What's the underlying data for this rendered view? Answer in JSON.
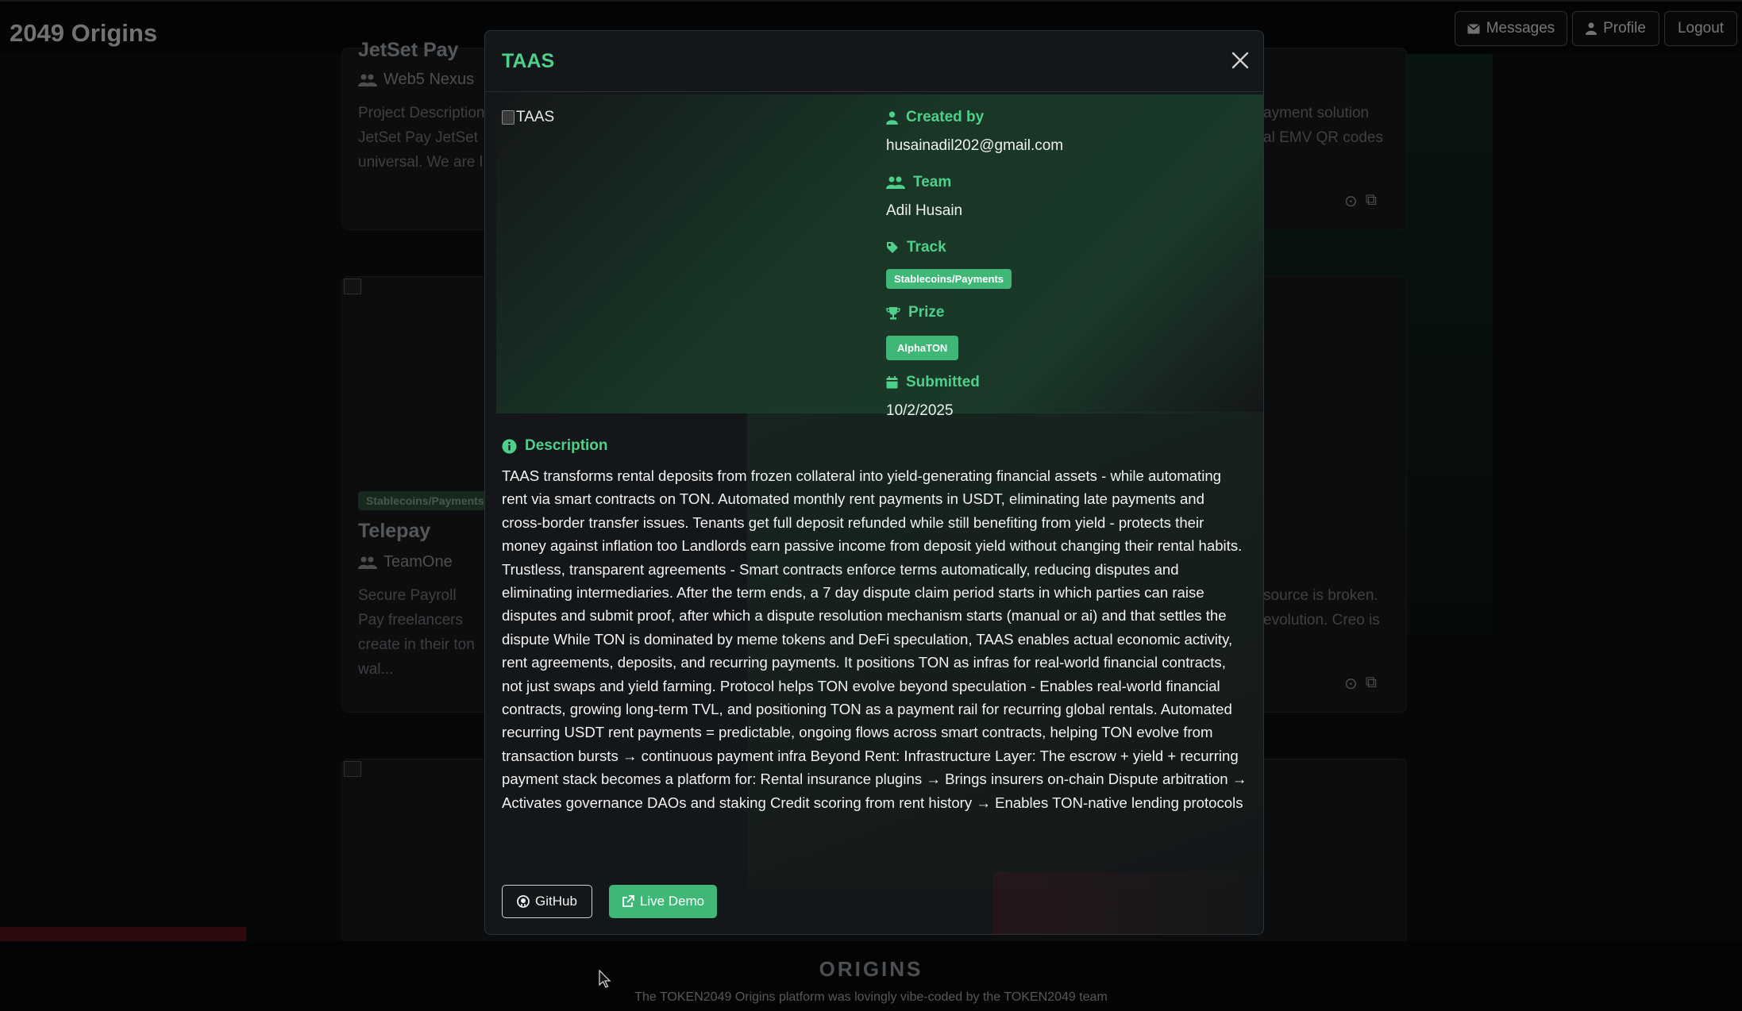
{
  "navbar": {
    "brand": "2049 Origins",
    "messages_label": "Messages",
    "profile_label": "Profile",
    "logout_label": "Logout"
  },
  "background_cards": [
    {
      "title": "JetSet Pay",
      "team": "Web5 Nexus",
      "description_left": "Project Description JetSet Pay JetSet universal. We are l",
      "description_right": [
        "ayment solution",
        "al EMV QR codes"
      ]
    },
    {
      "badge": "Stablecoins/Payments",
      "title": "Telepay",
      "team": "TeamOne",
      "description_left": "Secure Payroll Pay freelancers create in their ton wal...",
      "description_right": [
        "source is broken.",
        "evolution. Creo is"
      ]
    }
  ],
  "modal": {
    "title": "TAAS",
    "image_alt": "TAAS",
    "created_by_label": "Created by",
    "created_by_value": "husainadil202@gmail.com",
    "team_label": "Team",
    "team_value": "Adil Husain",
    "track_label": "Track",
    "track_value": "Stablecoins/Payments",
    "prize_label": "Prize",
    "prize_value": "AlphaTON",
    "submitted_label": "Submitted",
    "submitted_value": "10/2/2025",
    "description_label": "Description",
    "description": "TAAS transforms rental deposits from frozen collateral into yield-generating financial assets - while automating rent via smart contracts on TON. Automated monthly rent payments in USDT, eliminating late payments and cross-border transfer issues. Tenants get full deposit refunded while still benefiting from yield - protects their money against inflation too Landlords earn passive income from deposit yield without changing their rental habits. Trustless, transparent agreements - Smart contracts enforce terms automatically, reducing disputes and eliminating intermediaries. After the term ends, a 7 day dispute claim period starts in which parties can raise disputes and submit proof, after which a dispute resolution mechanism starts (manual or ai) and that settles the dispute While TON is dominated by meme tokens and DeFi speculation, TAAS enables actual economic activity, rent agreements, deposits, and recurring payments. It positions TON as infras for real-world financial contracts, not just swaps and yield farming. Protocol helps TON evolve beyond speculation - Enables real-world financial contracts, growing long-term TVL, and positioning TON as a payment rail for recurring global rentals. Automated recurring USDT rent payments = predictable, ongoing flows across smart contracts, helping TON evolve from transaction bursts → continuous payment infra Beyond Rent: Infrastructure Layer: The escrow + yield + recurring payment stack becomes a platform for: Rental insurance plugins → Brings insurers on-chain Dispute arbitration → Activates governance DAOs and staking Credit scoring from rent history → Enables TON-native lending protocols",
    "github_label": "GitHub",
    "demo_label": "Live Demo"
  },
  "footer": {
    "logo": "ORIGINS",
    "text": "The TOKEN2049 Origins platform was lovingly vibe-coded by the TOKEN2049 team"
  },
  "colors": {
    "accent": "#4fd08a",
    "badge": "#3fb877",
    "modal_bg": "#141719",
    "page_bg": "#0b0d10"
  }
}
